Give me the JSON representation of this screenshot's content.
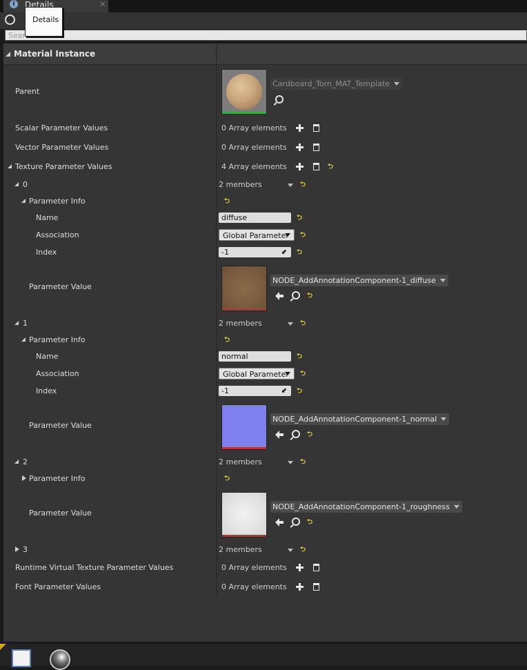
{
  "tab": {
    "label": "Details"
  },
  "tooltip": {
    "text": "Details"
  },
  "search": {
    "placeholder": "Search Details"
  },
  "section": {
    "title": "Material Instance"
  },
  "parent": {
    "label": "Parent",
    "asset": "Cardboard_Torn_MAT_Template"
  },
  "scalar": {
    "label": "Scalar Parameter Values",
    "value": "0 Array elements"
  },
  "vector": {
    "label": "Vector Parameter Values",
    "value": "0 Array elements"
  },
  "texture": {
    "label": "Texture Parameter Values",
    "value": "4 Array elements"
  },
  "elements": [
    {
      "index": "0",
      "members": "2 members",
      "info_label": "Parameter Info",
      "name_label": "Name",
      "name_value": "diffuse",
      "assoc_label": "Association",
      "assoc_value": "Global Parameter",
      "index_label": "Index",
      "index_value": "-1",
      "pv_label": "Parameter Value",
      "asset": "NODE_AddAnnotationComponent-1_diffuse"
    },
    {
      "index": "1",
      "members": "2 members",
      "info_label": "Parameter Info",
      "name_label": "Name",
      "name_value": "normal",
      "assoc_label": "Association",
      "assoc_value": "Global Parameter",
      "index_label": "Index",
      "index_value": "-1",
      "pv_label": "Parameter Value",
      "asset": "NODE_AddAnnotationComponent-1_normal"
    },
    {
      "index": "2",
      "members": "2 members",
      "info_label": "Parameter Info",
      "pv_label": "Parameter Value",
      "asset": "NODE_AddAnnotationComponent-1_roughness"
    },
    {
      "index": "3",
      "members": "2 members"
    }
  ],
  "rvt": {
    "label": "Runtime Virtual Texture Parameter Values",
    "value": "0 Array elements"
  },
  "font": {
    "label": "Font Parameter Values",
    "value": "0 Array elements"
  },
  "colors": {
    "diffuse_bar": "#b03a3a",
    "parent_bar": "#3aa84a",
    "normal_thumb": "#7f7ff0",
    "reset_icon": "#e7d63a"
  }
}
